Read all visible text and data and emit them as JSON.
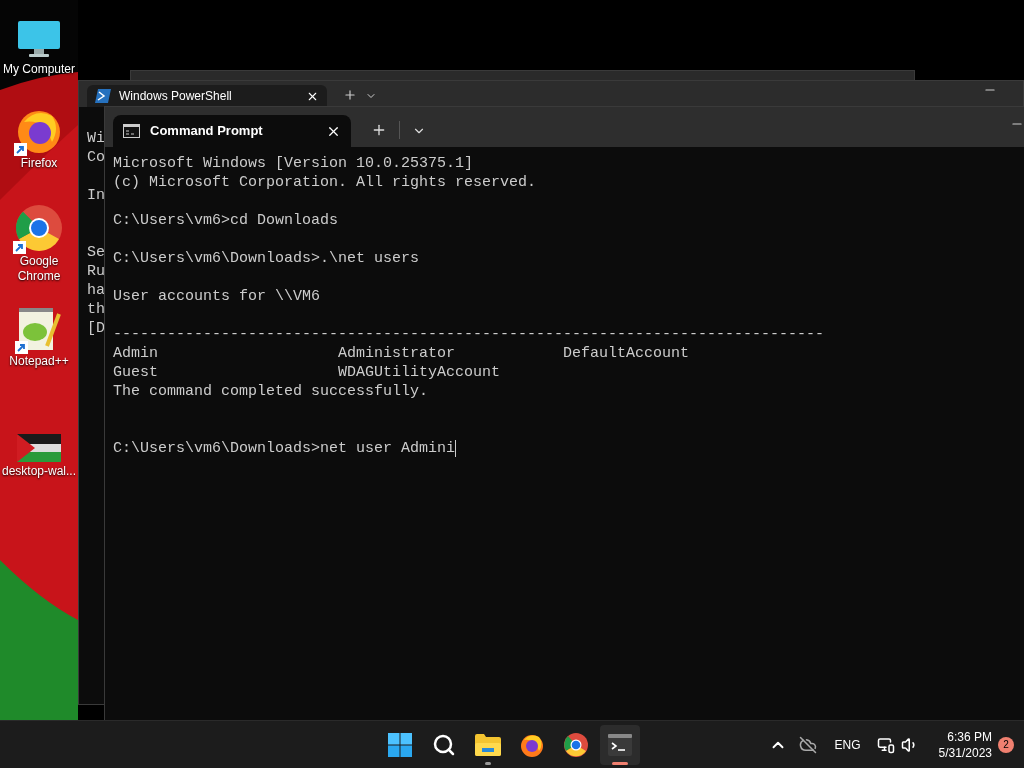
{
  "desktop_icons": [
    {
      "kind": "computer",
      "label": "My Computer",
      "shortcut": false
    },
    {
      "kind": "firefox",
      "label": "Firefox",
      "shortcut": true
    },
    {
      "kind": "chrome",
      "label": "Google Chrome",
      "shortcut": true
    },
    {
      "kind": "notepad",
      "label": "Notepad++",
      "shortcut": true
    },
    {
      "kind": "picture",
      "label": "desktop-wal...",
      "shortcut": false
    }
  ],
  "back_window": {
    "tab": {
      "title": "Windows PowerShell"
    },
    "lines": [
      {
        "kind": "text",
        "text": "Wi"
      },
      {
        "kind": "text",
        "text": "Co"
      },
      {
        "kind": "blank"
      },
      {
        "kind": "text",
        "text": "In"
      },
      {
        "kind": "blank"
      },
      {
        "kind": "blank"
      },
      {
        "kind": "text",
        "text": "Se"
      },
      {
        "kind": "text",
        "text": "Ru"
      },
      {
        "kind": "text",
        "text": "ha"
      },
      {
        "kind": "text",
        "text": "th"
      },
      {
        "kind": "text",
        "text": "[D"
      }
    ]
  },
  "front_window": {
    "tab": {
      "title": "Command Prompt"
    },
    "lines": [
      {
        "kind": "text",
        "text": "Microsoft Windows [Version 10.0.25375.1]"
      },
      {
        "kind": "text",
        "text": "(c) Microsoft Corporation. All rights reserved."
      },
      {
        "kind": "blank"
      },
      {
        "kind": "text",
        "text": "C:\\Users\\vm6>cd Downloads"
      },
      {
        "kind": "blank"
      },
      {
        "kind": "text",
        "text": "C:\\Users\\vm6\\Downloads>.\\net users"
      },
      {
        "kind": "blank"
      },
      {
        "kind": "text",
        "text": "User accounts for \\\\VM6"
      },
      {
        "kind": "blank"
      },
      {
        "kind": "text",
        "text": "-------------------------------------------------------------------------------"
      },
      {
        "kind": "columns",
        "cells": [
          "Admin",
          "Administrator",
          "DefaultAccount"
        ]
      },
      {
        "kind": "columns",
        "cells": [
          "Guest",
          "WDAGUtilityAccount"
        ]
      },
      {
        "kind": "text",
        "text": "The command completed successfully."
      },
      {
        "kind": "blank"
      },
      {
        "kind": "blank"
      },
      {
        "kind": "prompt",
        "text": "C:\\Users\\vm6\\Downloads>net user Admini"
      }
    ]
  },
  "taskbar": {
    "apps": [
      {
        "kind": "start",
        "running": false,
        "active": false
      },
      {
        "kind": "search",
        "running": false,
        "active": false
      },
      {
        "kind": "explorer",
        "running": true,
        "active": false
      },
      {
        "kind": "firefox",
        "running": false,
        "active": false
      },
      {
        "kind": "chrome",
        "running": false,
        "active": false
      },
      {
        "kind": "terminal",
        "running": true,
        "active": true
      }
    ],
    "language": "ENG",
    "time": "6:36 PM",
    "date": "5/31/2023",
    "notifications": "2"
  }
}
